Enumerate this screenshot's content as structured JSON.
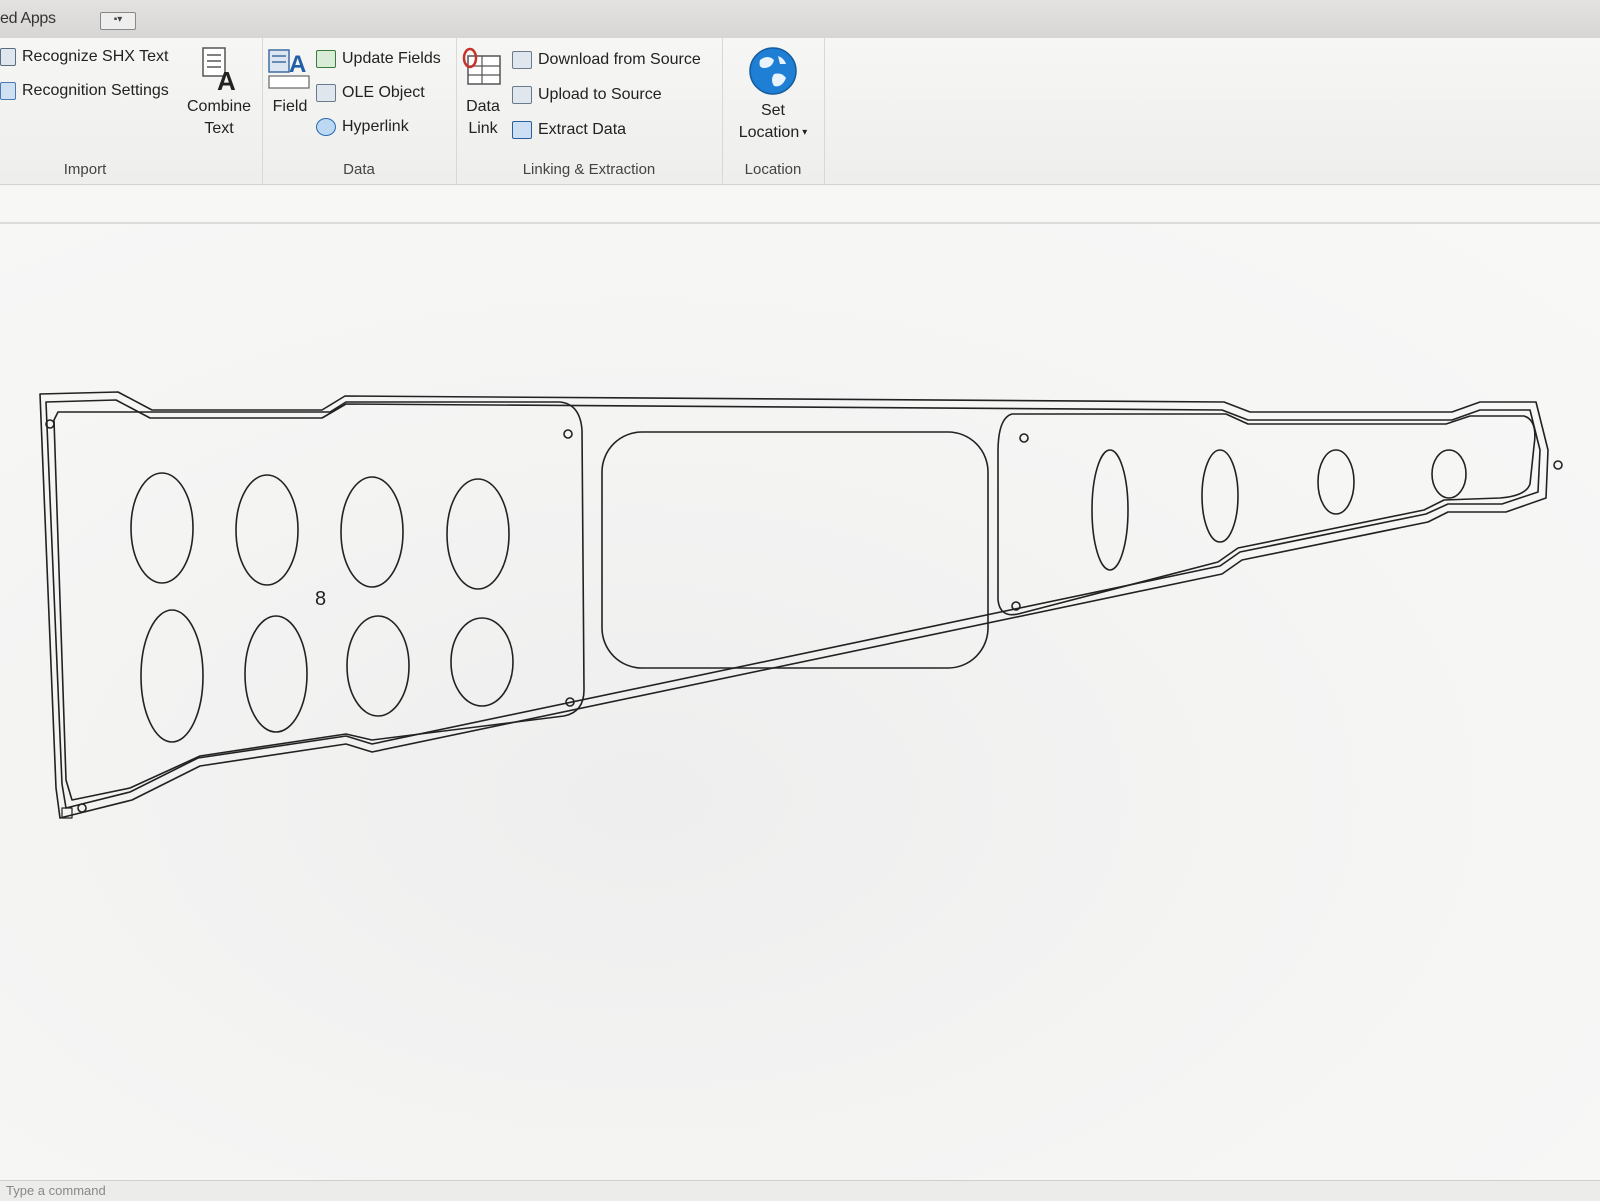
{
  "titlebar": {
    "title": "ed Apps",
    "button_label": "▪▾"
  },
  "ribbon": {
    "import": {
      "recognize_shx": "Recognize SHX Text",
      "recognition_settings": "Recognition Settings",
      "combine_text_line1": "Combine",
      "combine_text_line2": "Text",
      "label": "Import"
    },
    "data": {
      "field": "Field",
      "update_fields": "Update Fields",
      "ole_object": "OLE Object",
      "hyperlink": "Hyperlink",
      "label": "Data"
    },
    "linking": {
      "data_link_line1": "Data",
      "data_link_line2": "Link",
      "download_from_source": "Download from Source",
      "upload_to_source": "Upload to Source",
      "extract_data": "Extract  Data",
      "label": "Linking & Extraction"
    },
    "location": {
      "set_location_line1": "Set",
      "set_location_line2": "Location",
      "label": "Location"
    }
  },
  "drawing": {
    "label_8": "8",
    "stroke_color": "#222222"
  },
  "command_line": {
    "prompt": "Type a command"
  }
}
